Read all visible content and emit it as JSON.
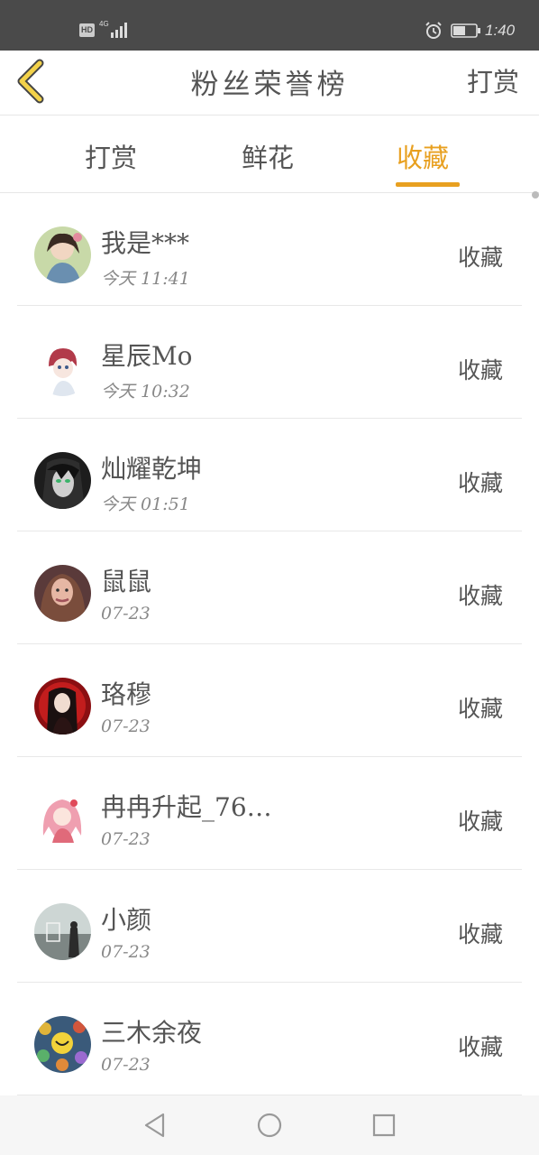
{
  "status_bar": {
    "hd": "HD",
    "network": "4G",
    "time": "1:40"
  },
  "header": {
    "title": "粉丝荣誉榜",
    "right_link": "打赏"
  },
  "tabs": [
    {
      "label": "打赏",
      "active": false
    },
    {
      "label": "鲜花",
      "active": false
    },
    {
      "label": "收藏",
      "active": true
    }
  ],
  "accent_color": "#e8a020",
  "fans": [
    {
      "name": "我是***",
      "time": "今天 11:41",
      "action": "收藏"
    },
    {
      "name": "星辰Mo",
      "time": "今天 10:32",
      "action": "收藏"
    },
    {
      "name": "灿耀乾坤",
      "time": "今天 01:51",
      "action": "收藏"
    },
    {
      "name": "鼠鼠",
      "time": "07-23",
      "action": "收藏"
    },
    {
      "name": "珞穆",
      "time": "07-23",
      "action": "收藏"
    },
    {
      "name": "冉冉升起_76…",
      "time": "07-23",
      "action": "收藏"
    },
    {
      "name": "小颜",
      "time": "07-23",
      "action": "收藏"
    },
    {
      "name": "三木余夜",
      "time": "07-23",
      "action": "收藏"
    }
  ]
}
